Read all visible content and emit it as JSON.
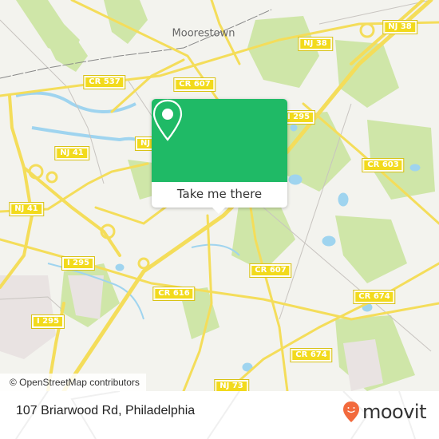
{
  "map": {
    "place_label": "Moorestown",
    "shields": [
      {
        "label": "NJ 38",
        "id": "nj38-east"
      },
      {
        "label": "NJ 38",
        "id": "nj38-west"
      },
      {
        "label": "CR 537",
        "id": "cr537"
      },
      {
        "label": "CR 607",
        "id": "cr607-north"
      },
      {
        "label": "I 295",
        "id": "i295-north"
      },
      {
        "label": "NJ 41",
        "id": "nj41-mid"
      },
      {
        "label": "NJ",
        "id": "nj-partial"
      },
      {
        "label": "NJ 41",
        "id": "nj41-south"
      },
      {
        "label": "CR 603",
        "id": "cr603"
      },
      {
        "label": "I 295",
        "id": "i295-west"
      },
      {
        "label": "CR 607",
        "id": "cr607-south"
      },
      {
        "label": "CR 616",
        "id": "cr616"
      },
      {
        "label": "CR 674",
        "id": "cr674-east"
      },
      {
        "label": "I 295",
        "id": "i295-southwest"
      },
      {
        "label": "CR 674",
        "id": "cr674-south"
      },
      {
        "label": "NJ 73",
        "id": "nj73"
      }
    ],
    "attribution": "© OpenStreetMap contributors",
    "colors": {
      "background": "#f3f3ee",
      "park": "#cfe6a8",
      "water": "#9fd4ef",
      "road": "#f4dd5a",
      "accent": "#1fba66"
    }
  },
  "popup": {
    "icon": "map-pin-icon",
    "button_label": "Take me there"
  },
  "footer": {
    "address": "107 Briarwood Rd, Philadelphia",
    "brand": "moovit",
    "brand_color": "#f26a3d"
  }
}
